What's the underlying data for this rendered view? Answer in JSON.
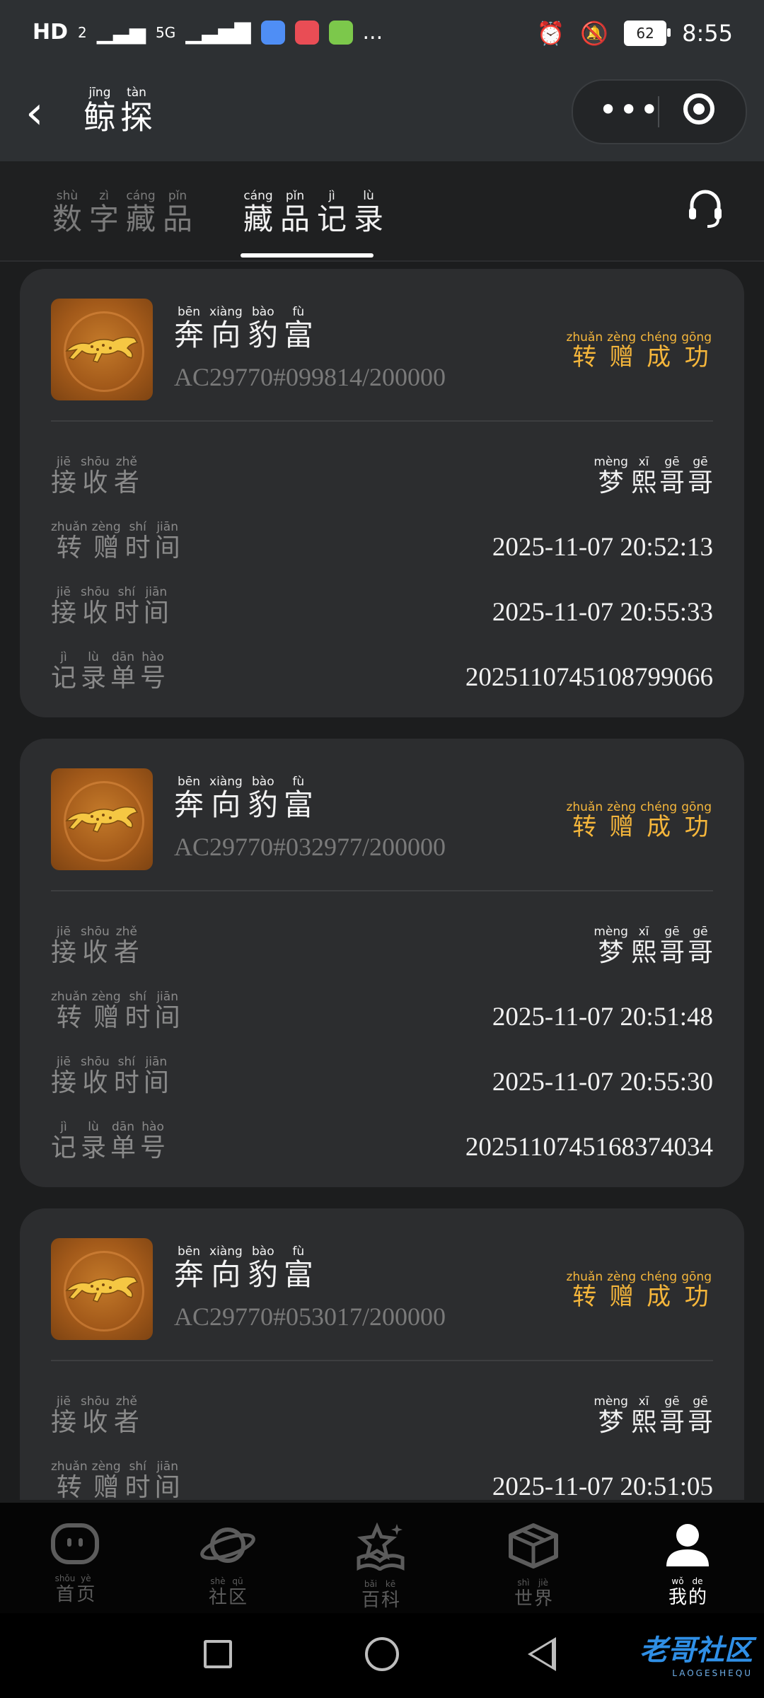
{
  "status_bar": {
    "left_items": [
      "HD",
      "2",
      "5G",
      "..."
    ],
    "battery": "62",
    "time": "8:55"
  },
  "header": {
    "back_icon": "chevron-left-icon",
    "title": [
      {
        "hz": "鲸",
        "py": "jīng"
      },
      {
        "hz": "探",
        "py": "tàn"
      }
    ],
    "more_icon": "more-dots-icon",
    "target_icon": "target-icon"
  },
  "tabs": [
    {
      "chars": [
        {
          "hz": "数",
          "py": "shù"
        },
        {
          "hz": "字",
          "py": "zì"
        },
        {
          "hz": "藏",
          "py": "cáng"
        },
        {
          "hz": "品",
          "py": "pǐn"
        }
      ],
      "active": false
    },
    {
      "chars": [
        {
          "hz": "藏",
          "py": "cáng"
        },
        {
          "hz": "品",
          "py": "pǐn"
        },
        {
          "hz": "记",
          "py": "jì"
        },
        {
          "hz": "录",
          "py": "lù"
        }
      ],
      "active": true
    }
  ],
  "labels": {
    "item_name": [
      {
        "hz": "奔",
        "py": "bēn"
      },
      {
        "hz": "向",
        "py": "xiàng"
      },
      {
        "hz": "豹",
        "py": "bào"
      },
      {
        "hz": "富",
        "py": "fù"
      }
    ],
    "status": [
      {
        "hz": "转",
        "py": "zhuǎn"
      },
      {
        "hz": "赠",
        "py": "zèng"
      },
      {
        "hz": "成",
        "py": "chéng"
      },
      {
        "hz": "功",
        "py": "gōng"
      }
    ],
    "receiver": [
      {
        "hz": "接",
        "py": "jiē"
      },
      {
        "hz": "收",
        "py": "shōu"
      },
      {
        "hz": "者",
        "py": "zhě"
      }
    ],
    "transfer_time": [
      {
        "hz": "转",
        "py": "zhuǎn"
      },
      {
        "hz": "赠",
        "py": "zèng"
      },
      {
        "hz": "时",
        "py": "shí"
      },
      {
        "hz": "间",
        "py": "jiān"
      }
    ],
    "receive_time": [
      {
        "hz": "接",
        "py": "jiē"
      },
      {
        "hz": "收",
        "py": "shōu"
      },
      {
        "hz": "时",
        "py": "shí"
      },
      {
        "hz": "间",
        "py": "jiān"
      }
    ],
    "record_no": [
      {
        "hz": "记",
        "py": "jì"
      },
      {
        "hz": "录",
        "py": "lù"
      },
      {
        "hz": "单",
        "py": "dān"
      },
      {
        "hz": "号",
        "py": "hào"
      }
    ],
    "receiver_name": [
      {
        "hz": "梦",
        "py": "mèng"
      },
      {
        "hz": "熙",
        "py": "xī"
      },
      {
        "hz": "哥",
        "py": "gē"
      },
      {
        "hz": "哥",
        "py": "gē"
      }
    ]
  },
  "records": [
    {
      "serial": "AC29770#099814/200000",
      "transfer_time": "2025-11-07 20:52:13",
      "receive_time": "2025-11-07 20:55:33",
      "record_no": "2025110745108799066"
    },
    {
      "serial": "AC29770#032977/200000",
      "transfer_time": "2025-11-07 20:51:48",
      "receive_time": "2025-11-07 20:55:30",
      "record_no": "2025110745168374034"
    },
    {
      "serial": "AC29770#053017/200000",
      "transfer_time": "2025-11-07 20:51:05",
      "receive_time": "",
      "record_no": ""
    }
  ],
  "bottom_nav": [
    {
      "icon": "home-face-icon",
      "chars": [
        {
          "hz": "首",
          "py": "shǒu"
        },
        {
          "hz": "页",
          "py": "yè"
        }
      ],
      "active": false
    },
    {
      "icon": "planet-icon",
      "chars": [
        {
          "hz": "社",
          "py": "shè"
        },
        {
          "hz": "区",
          "py": "qū"
        }
      ],
      "active": false
    },
    {
      "icon": "book-star-icon",
      "chars": [
        {
          "hz": "百",
          "py": "bǎi"
        },
        {
          "hz": "科",
          "py": "kē"
        }
      ],
      "active": false
    },
    {
      "icon": "box-icon",
      "chars": [
        {
          "hz": "世",
          "py": "shì"
        },
        {
          "hz": "界",
          "py": "jiè"
        }
      ],
      "active": false
    },
    {
      "icon": "user-icon",
      "chars": [
        {
          "hz": "我",
          "py": "wǒ"
        },
        {
          "hz": "的",
          "py": "de"
        }
      ],
      "active": true
    }
  ],
  "watermark": {
    "main": "老哥社区",
    "sub": "LAOGESHEQU"
  }
}
